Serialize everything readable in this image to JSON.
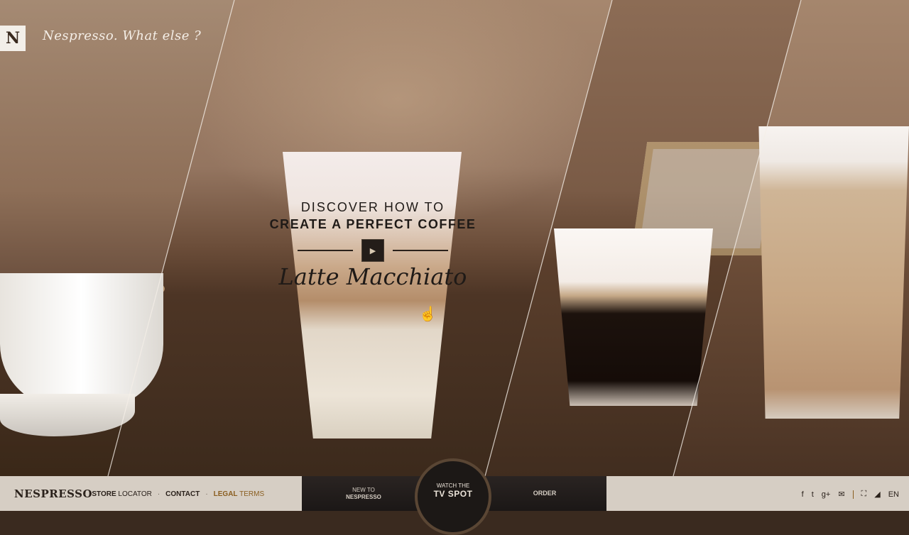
{
  "header": {
    "logo_letter": "N",
    "tagline": "Nespresso. What else ?"
  },
  "hero": {
    "line1": "DISCOVER HOW TO",
    "line2": "CREATE A PERFECT COFFEE",
    "drink": "Latte Macchiato",
    "play_icon": "▶"
  },
  "footer": {
    "brand": "NESPRESSO",
    "nav": {
      "store_b": "STORE",
      "store_rest": "LOCATOR",
      "contact": "CONTACT",
      "legal_b": "LEGAL",
      "legal_rest": "TERMS",
      "dot": "·"
    },
    "new_to_small": "NEW TO",
    "new_to_big": "NESPRESSO",
    "watch_small": "WATCH THE",
    "watch_big": "TV SPOT",
    "order": "ORDER",
    "social": {
      "facebook": "f",
      "twitter": "t",
      "google": "g+",
      "mail": "✉",
      "fullscreen": "⛶",
      "sound": "◢",
      "lang": "EN"
    }
  },
  "colors": {
    "accent": "#8a5e20",
    "footer_bg": "#d6cec4",
    "dark_bar": "#1b1716"
  }
}
